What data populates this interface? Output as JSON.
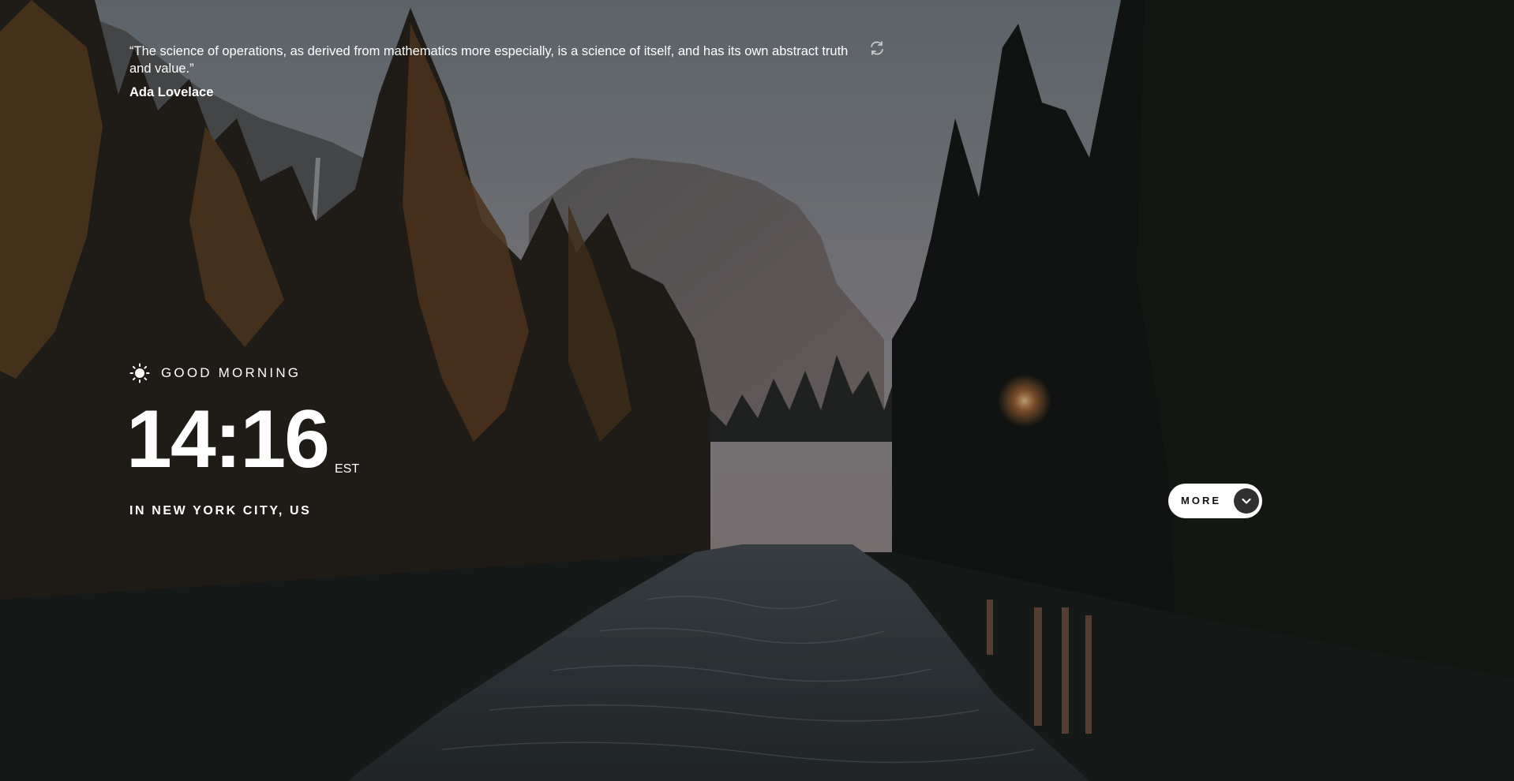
{
  "quote": {
    "text": "“The science of operations, as derived from mathematics more especially, is a science of itself, and has its own abstract truth and value.”",
    "author": "Ada Lovelace"
  },
  "icons": {
    "refresh": "refresh-icon",
    "weather": "sun-icon",
    "more": "chevron-down-icon"
  },
  "clock": {
    "greeting": "GOOD MORNING",
    "time": "14:16",
    "timezone": "EST",
    "location": "IN NEW YORK CITY, US"
  },
  "more_button": {
    "label": "MORE"
  },
  "colors": {
    "text": "#ffffff",
    "button_bg": "#ffffff",
    "button_text": "#111111",
    "chevron_bg": "#303030"
  }
}
